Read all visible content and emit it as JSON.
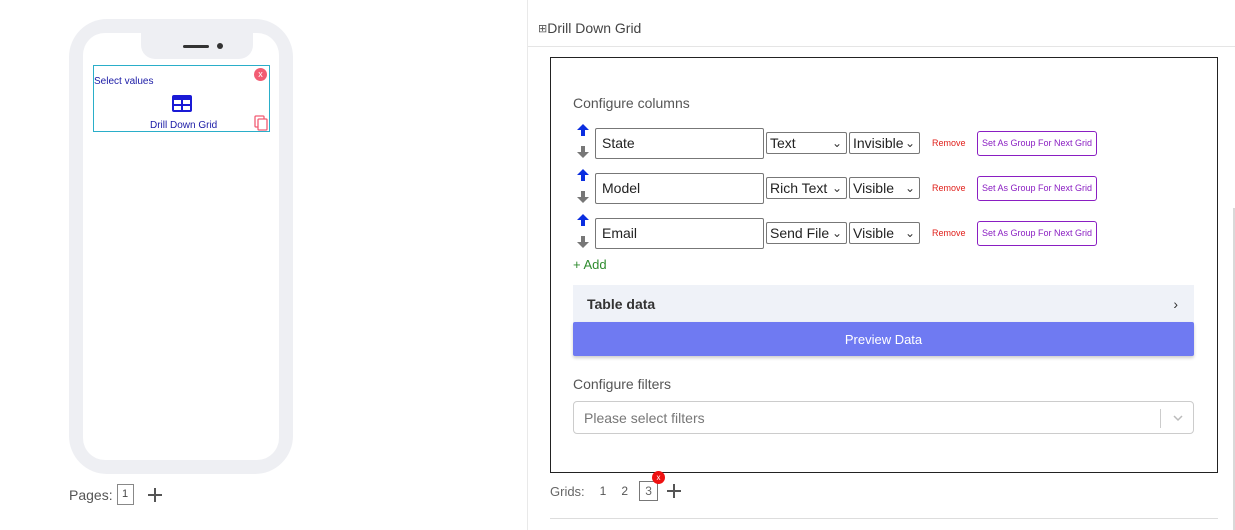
{
  "phone": {
    "widget": {
      "label": "Select values",
      "title": "Drill Down Grid",
      "close": "x",
      "icon": "table-grid-icon",
      "copy_icon": "copy-icon"
    },
    "pages_label": "Pages:",
    "pages": [
      "1"
    ]
  },
  "panel": {
    "header_icon": "⊞",
    "header_title": "Drill Down Grid",
    "configure_columns": "Configure columns",
    "columns": [
      {
        "name": "State",
        "type": "Text",
        "visibility": "Invisible",
        "remove": "Remove",
        "group": "Set As Group For Next Grid"
      },
      {
        "name": "Model",
        "type": "Rich Text",
        "visibility": "Visible",
        "remove": "Remove",
        "group": "Set As Group For Next Grid"
      },
      {
        "name": "Email",
        "type": "Send File",
        "visibility": "Visible",
        "remove": "Remove",
        "group": "Set As Group For Next Grid"
      }
    ],
    "add": "+ Add",
    "table_data": "Table data",
    "table_data_chevron": "›",
    "preview_button": "Preview Data",
    "configure_filters": "Configure filters",
    "filters_placeholder": "Please select filters",
    "grids_label": "Grids:",
    "grids": [
      "1",
      "2",
      "3"
    ],
    "active_grid_close": "x"
  },
  "colors": {
    "accent": "#6f7af2",
    "remove": "#e0201b",
    "group_button": "#8a1ec2",
    "add": "#2e8b2e",
    "widget_border": "#2aaec9",
    "widget_text": "#1a1aa6",
    "arrow_up": "#0b2ee0",
    "arrow_down": "#777777"
  }
}
